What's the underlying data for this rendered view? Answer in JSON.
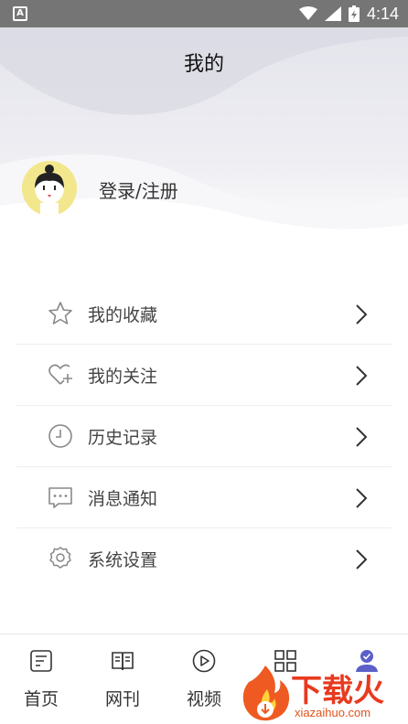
{
  "status_bar": {
    "left_badge": "A",
    "time": "4:14"
  },
  "header": {
    "title": "我的"
  },
  "profile": {
    "login_text": "登录/注册"
  },
  "menu": {
    "items": [
      {
        "label": "我的收藏",
        "icon": "star-icon"
      },
      {
        "label": "我的关注",
        "icon": "heart-plus-icon"
      },
      {
        "label": "历史记录",
        "icon": "clock-icon"
      },
      {
        "label": "消息通知",
        "icon": "message-icon"
      },
      {
        "label": "系统设置",
        "icon": "gear-icon"
      }
    ]
  },
  "tab_bar": {
    "tabs": [
      {
        "label": "首页",
        "icon": "home-doc-icon"
      },
      {
        "label": "网刊",
        "icon": "book-icon"
      },
      {
        "label": "视频",
        "icon": "play-icon"
      },
      {
        "label": "",
        "icon": "apps-grid-icon"
      },
      {
        "label": "",
        "icon": "user-icon",
        "active": true
      }
    ],
    "active_color": "#5b5fc7"
  },
  "watermark": {
    "text": "下载火",
    "url": "xiazaihuo.com"
  }
}
